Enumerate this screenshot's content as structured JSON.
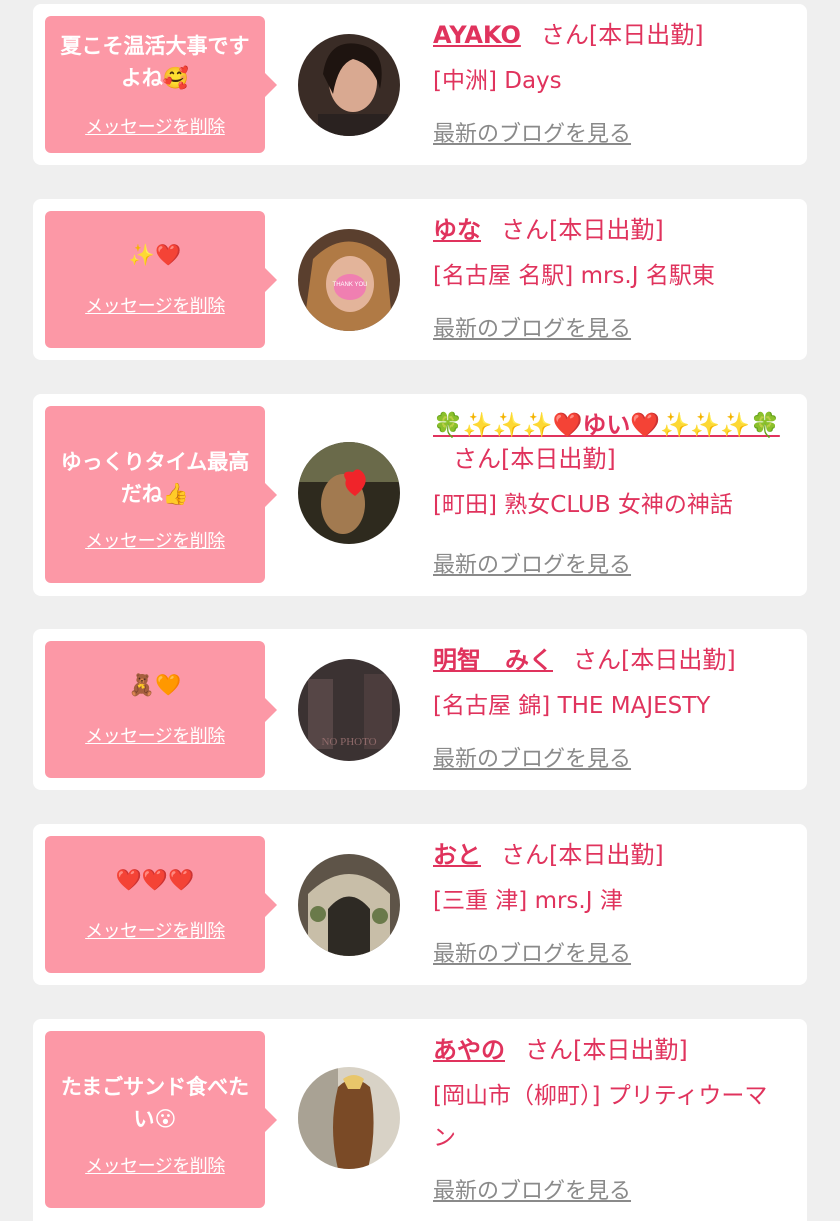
{
  "items": [
    {
      "message": "夏こそ温活大事ですよね🥰",
      "delete_label": "メッセージを削除",
      "name": "AYAKO",
      "name_suffix": "さん[本日出勤]",
      "shop": "[中洲] Days",
      "blog_link": "最新のブログを見る"
    },
    {
      "message": "✨❤️",
      "delete_label": "メッセージを削除",
      "name": "ゆな",
      "name_suffix": "さん[本日出勤]",
      "shop": "[名古屋 名駅] mrs.J 名駅東",
      "blog_link": "最新のブログを見る"
    },
    {
      "message": "ゆっくりタイム最高だね👍",
      "delete_label": "メッセージを削除",
      "name": "🍀✨✨✨❤️ゆい❤️✨✨✨🍀",
      "name_suffix": "さん[本日出勤]",
      "shop": "[町田] 熟女CLUB 女神の神話",
      "blog_link": "最新のブログを見る"
    },
    {
      "message": "🧸🧡",
      "delete_label": "メッセージを削除",
      "name": "明智　みく",
      "name_suffix": "さん[本日出勤]",
      "shop": "[名古屋 錦] THE MAJESTY",
      "blog_link": "最新のブログを見る"
    },
    {
      "message": "❤️❤️❤️",
      "delete_label": "メッセージを削除",
      "name": "おと",
      "name_suffix": "さん[本日出勤]",
      "shop": "[三重 津] mrs.J 津",
      "blog_link": "最新のブログを見る"
    },
    {
      "message": "たまごサンド食べたい😮",
      "delete_label": "メッセージを削除",
      "name": "あやの",
      "name_suffix": "さん[本日出勤]",
      "shop": "[岡山市（柳町）] プリティウーマン",
      "blog_link": "最新のブログを見る"
    }
  ],
  "avatar_images": [
    {
      "text": ""
    },
    {
      "text": "THANK YOU"
    },
    {
      "text": ""
    },
    {
      "text": "NO PHOTO"
    },
    {
      "text": ""
    },
    {
      "text": ""
    }
  ],
  "colors": {
    "page_bg": "#efefef",
    "card_bg": "#ffffff",
    "bubble_bg": "#fc98a6",
    "accent": "#e0335d",
    "link_gray": "#8a8a8a"
  }
}
